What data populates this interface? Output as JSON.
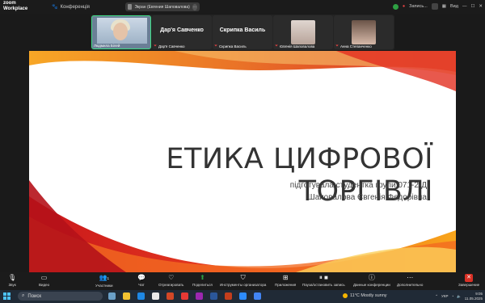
{
  "topbar": {
    "logo_line1": "zoom",
    "logo_line2": "Workplace",
    "conference_label": "Конференція",
    "share_label": "Экран (Евгения Шаповалова)",
    "recording_label": "Запись...",
    "view_label": "Вид"
  },
  "gallery": {
    "tiles": [
      {
        "name": "Людмила Білей",
        "big": ""
      },
      {
        "name": "Дар'я Савченко",
        "big": "Дар'я Савченко"
      },
      {
        "name": "Скрипка Василь",
        "big": "Скрипка Василь"
      },
      {
        "name": "Євгенія Шаповалова",
        "big": ""
      },
      {
        "name": "Анна Степанченко",
        "big": ""
      }
    ]
  },
  "slide": {
    "title": "ЕТИКА ЦИФРОВОЇ ТОРГІВЛІ",
    "subtitle_line1": "підготувала студентка групи 071-2-Д",
    "subtitle_line2": "Шаповалова Євгенія Федорівна"
  },
  "toolbar": {
    "audio": "Звук",
    "video": "Видео",
    "participants": "Участники",
    "participants_count": "1",
    "chat": "Чат",
    "react": "Отреагировать",
    "share": "Поделиться",
    "host_tools": "Инструменты организатора",
    "apps": "Приложения",
    "pause_record": "Пауза/остановить запись",
    "info": "Данные конференции",
    "more": "Дополнительно",
    "end": "Завершение"
  },
  "taskbar": {
    "search_placeholder": "Поиск",
    "weather": "11°C  Mostly sunny",
    "lang": "УКР",
    "time": "9:05",
    "date": "11.05.2025"
  },
  "colors": {
    "accent_green": "#2ea043",
    "end_red": "#d93025",
    "slide_wave_red": "#e02b20",
    "slide_wave_orange": "#f7a21b"
  }
}
